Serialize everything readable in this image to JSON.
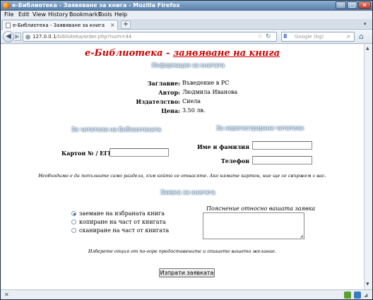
{
  "window": {
    "title": "е-Библиотека - Заявяване за книга - Mozilla Firefox",
    "min_glyph": "–",
    "max_glyph": "□",
    "close_glyph": "✕"
  },
  "menu": [
    "File",
    "Edit",
    "View",
    "History",
    "Bookmarks",
    "Tools",
    "Help"
  ],
  "tab": {
    "label": "е-Библиотека - Заявяване за книга",
    "close_glyph": "×",
    "new_tab_glyph": "+"
  },
  "nav": {
    "url_host": "127.0.0.1",
    "url_path": "/biblioteka/order.php?num=44",
    "search_engine": "8",
    "search_placeholder": "Google (bg)"
  },
  "page": {
    "heading_prefix": "е-Библиотека - ",
    "heading_underlined": "заявяване на книга",
    "book_section_title": "Информация за книгата",
    "book": {
      "title_label": "Заглавие:",
      "title_value": "Въведение в PC",
      "author_label": "Автор:",
      "author_value": "Людмила Иванова",
      "publisher_label": "Издателство:",
      "publisher_value": "Сиела",
      "price_label": "Цена:",
      "price_value": "3.50 лв."
    },
    "readers_title": "За читатели на Библиотеката",
    "card_label": "Картон № / ЕГН",
    "card_value": "",
    "unregistered_title": "За нерегистрирани читатели",
    "name_label": "Име и фамилия",
    "name_value": "",
    "phone_label": "Телефон",
    "phone_value": "",
    "fill_note": "Необходимо е да попълните само раздела, към който се отнасяте. Ако нямате картон, ние ще се свържем с вас.",
    "request_title": "Заявка за книгата",
    "options": [
      {
        "label": "заемане на избраната книга",
        "selected": true
      },
      {
        "label": "копиране на част от книгата",
        "selected": false
      },
      {
        "label": "сканиране на част от книгата",
        "selected": false
      }
    ],
    "comment_label": "Пояснение относно вашата заявка",
    "comment_value": "",
    "choose_note": "Изберете опция от по-горе предоставените и опишете вашето желание.",
    "submit_label": "Изпрати заявката"
  },
  "status": {
    "stop_glyph": "✕"
  },
  "colors": {
    "heading": "#cc0000",
    "section_glow": "#4b6f95"
  }
}
